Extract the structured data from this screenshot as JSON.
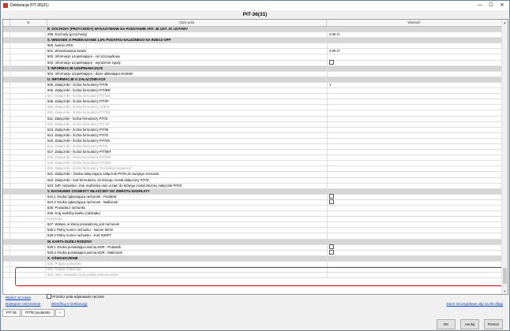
{
  "window": {
    "title": "Deklaracja PIT-36(31)",
    "minimize": "—",
    "maximize": "☐",
    "close": "✕"
  },
  "header": {
    "title": "PIT-36(31)"
  },
  "columns": {
    "a": "",
    "e": "E",
    "desc": "Opis pola",
    "val": "Wartość"
  },
  "rows": [
    {
      "type": "section",
      "desc": "R. DOCHODY (PRZYCHODY) WYKAZYWANE NA PODSTAWIE ART. 45 UST. 3C USTAWY",
      "val": ""
    },
    {
      "type": "row",
      "desc": "499. Dochody (przychody)",
      "val": "0,00 zł"
    },
    {
      "type": "section",
      "desc": "S. WNIOSEK O PRZEKAZANIE 1,5% PODATKU NALEŻNEGO NA RZECZ OPP",
      "val": ""
    },
    {
      "type": "row",
      "desc": "500. Numer KRS",
      "val": ""
    },
    {
      "type": "row",
      "desc": "501. Wnioskowana kwota",
      "val": "0,00 zł"
    },
    {
      "type": "row",
      "desc": "502. Informacje uzupełniające - cel szczegółowy",
      "val": ""
    },
    {
      "type": "row",
      "desc": "503. Informacje uzupełniające - wyrażenie zgody",
      "val": "",
      "check": true
    },
    {
      "type": "section",
      "desc": "T. INFORMACJE UZUPEŁNIAJĄCE",
      "val": ""
    },
    {
      "type": "row",
      "desc": "504. Informacje uzupełniające - dane ułatwiające kontakt",
      "val": ""
    },
    {
      "type": "section",
      "desc": "U. INFORMACJE O ZAŁĄCZNIKACH",
      "val": ""
    },
    {
      "type": "row",
      "desc": "505. Załączniki - liczba formularzy PIT/B",
      "val": "1"
    },
    {
      "type": "row",
      "desc": "506. Załączniki - liczba formularzy PIT/BR",
      "val": ""
    },
    {
      "type": "grey",
      "desc": "507. Załączniki - liczba formularzy PIT/DS",
      "val": ""
    },
    {
      "type": "row",
      "desc": "508. Załączniki - liczba formularzy PIT/IP",
      "val": ""
    },
    {
      "type": "grey",
      "desc": "509. Załączniki - liczba formularzy SSE-R",
      "val": ""
    },
    {
      "type": "grey",
      "desc": "510. Załączniki - liczba formularzy PIT/SE",
      "val": ""
    },
    {
      "type": "row",
      "desc": "511. Załączniki - liczba formularzy PIT/D",
      "val": ""
    },
    {
      "type": "grey",
      "desc": "512. Załączniki - liczba formularzy PIT-2K",
      "val": ""
    },
    {
      "type": "row",
      "desc": "513. Załączniki - liczba formularzy PIT/M",
      "val": ""
    },
    {
      "type": "row",
      "desc": "514. Załączniki - liczba formularzy PIT/O",
      "val": ""
    },
    {
      "type": "row",
      "desc": "515. Załączniki - liczba formularzy PIT/ZG",
      "val": ""
    },
    {
      "type": "grey",
      "desc": "516. Załączniki - liczba formularzy PIT/Z",
      "val": ""
    },
    {
      "type": "row",
      "desc": "517. Załączniki - liczba formularzy PIT/MIT",
      "val": ""
    },
    {
      "type": "grey",
      "desc": "518. Załączniki - liczba formularzy PIT/PM",
      "val": ""
    },
    {
      "type": "grey",
      "desc": "519. Załączniki - liczba formularzy PIT/NZI",
      "val": ""
    },
    {
      "type": "grey",
      "desc": "520. Załączniki - liczba formularzy \"Certyfikat rezydencji\"",
      "val": ""
    },
    {
      "type": "row",
      "desc": "521. Załączniki - Osoba dołączająca załącznik PIT/D do swojego zeznania",
      "val": ""
    },
    {
      "type": "row",
      "desc": "522. Załączniki - kod formularza, do którego został dołączony PIT/D",
      "val": ""
    },
    {
      "type": "row",
      "desc": "523. NIP, nazwisko i imię małżonka oraz urząd, do którego został złożony załącznik PIT/D",
      "val": ""
    },
    {
      "type": "section",
      "desc": "V. RACHUNEK OSOBISTY WŁAŚCIWY DO ZWROTU NADPŁATY",
      "val": ""
    },
    {
      "type": "row",
      "desc": "524.1 Osoba zgłaszająca rachunek - Podatnik",
      "val": "",
      "check": true
    },
    {
      "type": "row",
      "desc": "524.2 Osoba zgłaszająca rachunek - Małżonek",
      "val": "",
      "check": true
    },
    {
      "type": "row",
      "desc": "525. Posiadacz rachunku",
      "val": ""
    },
    {
      "type": "row",
      "desc": "526. Kraj siedziby banku (oddziału)",
      "val": ""
    },
    {
      "type": "grey",
      "desc": "Kod kraju",
      "val": ""
    },
    {
      "type": "row",
      "desc": "527. Waluta, w której prowadzony jest rachunek",
      "val": ""
    },
    {
      "type": "row",
      "desc": "528.1 Pełny numer rachunku - Numer IBAN",
      "val": ""
    },
    {
      "type": "row",
      "desc": "528.2 Pełny numer rachunku - Kod SWIFT",
      "val": ""
    },
    {
      "type": "section",
      "desc": "W. KARTA DUŻEJ RODZINY",
      "val": ""
    },
    {
      "type": "row",
      "desc": "529.1 Osoba posiadająca ważną KDR - Podatnik",
      "val": "",
      "check": true
    },
    {
      "type": "row",
      "desc": "529.2 Osoba posiadająca ważną KDR - Małżonek",
      "val": "",
      "check": true
    },
    {
      "type": "section",
      "desc": "X. OŚWIADCZENIE",
      "val": ""
    },
    {
      "type": "grey",
      "desc": "530. Podpis podatnika",
      "val": ""
    },
    {
      "type": "grey",
      "desc": "531. Podpis małżonka",
      "val": ""
    },
    {
      "type": "grey",
      "desc": "532. Imię i nazwisko oraz podpis pełnomocnika",
      "val": ""
    }
  ],
  "footer": {
    "wylicz": "Wylicz od nowa",
    "przelicz": "Przelicz pola edytowane ręcznie",
    "nastepne": "Następne ostrzeżenie",
    "weryfikuj": "Weryfikuj e-Deklarację",
    "dane_szczegolowe": "Dane szczegółowe ulgi na złe długi"
  },
  "tabs": [
    "PIT-36",
    "PIT/B (podatnik)",
    "+"
  ],
  "buttons": {
    "ok": "OK",
    "anuluj": "Anuluj",
    "pomoc": "Pomoc"
  }
}
